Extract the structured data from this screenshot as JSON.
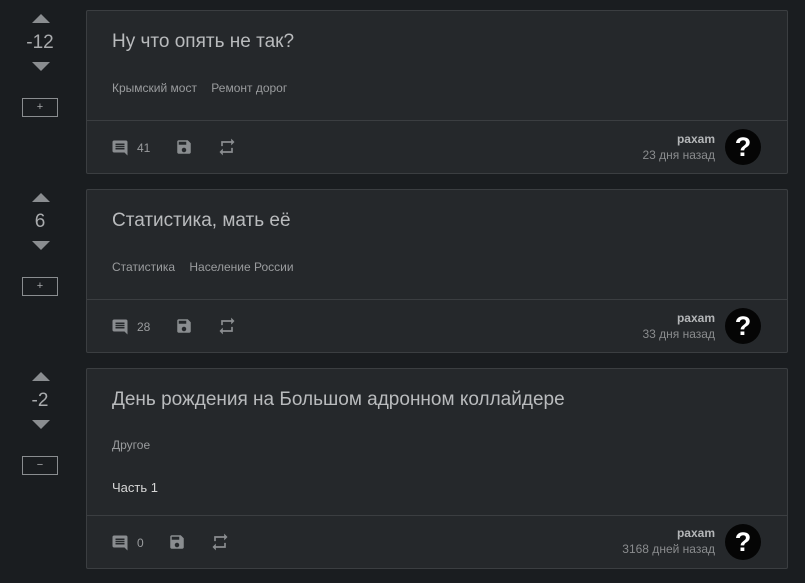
{
  "posts": [
    {
      "score": "-12",
      "toggle": "+",
      "title": "Ну что опять не так?",
      "tags": [
        "Крымский мост",
        "Ремонт дорог"
      ],
      "body": "",
      "comments": "41",
      "author": "paxam",
      "time": "23 дня назад",
      "avatar": "?"
    },
    {
      "score": "6",
      "toggle": "+",
      "title": "Статистика, мать её",
      "tags": [
        "Статистика",
        "Население России"
      ],
      "body": "",
      "comments": "28",
      "author": "paxam",
      "time": "33 дня назад",
      "avatar": "?"
    },
    {
      "score": "-2",
      "toggle": "−",
      "title": "День рождения на Большом адронном коллайдере",
      "tags": [
        "Другое"
      ],
      "body": "Часть 1",
      "comments": "0",
      "author": "paxam",
      "time": "3168 дней назад",
      "avatar": "?"
    }
  ],
  "icons": {
    "comment": "comment-icon",
    "save": "save-icon",
    "repost": "repost-icon"
  },
  "colors": {
    "background": "#1a1d20",
    "card": "#25282b",
    "border": "#3b3e41",
    "icon": "#8a8d90"
  }
}
